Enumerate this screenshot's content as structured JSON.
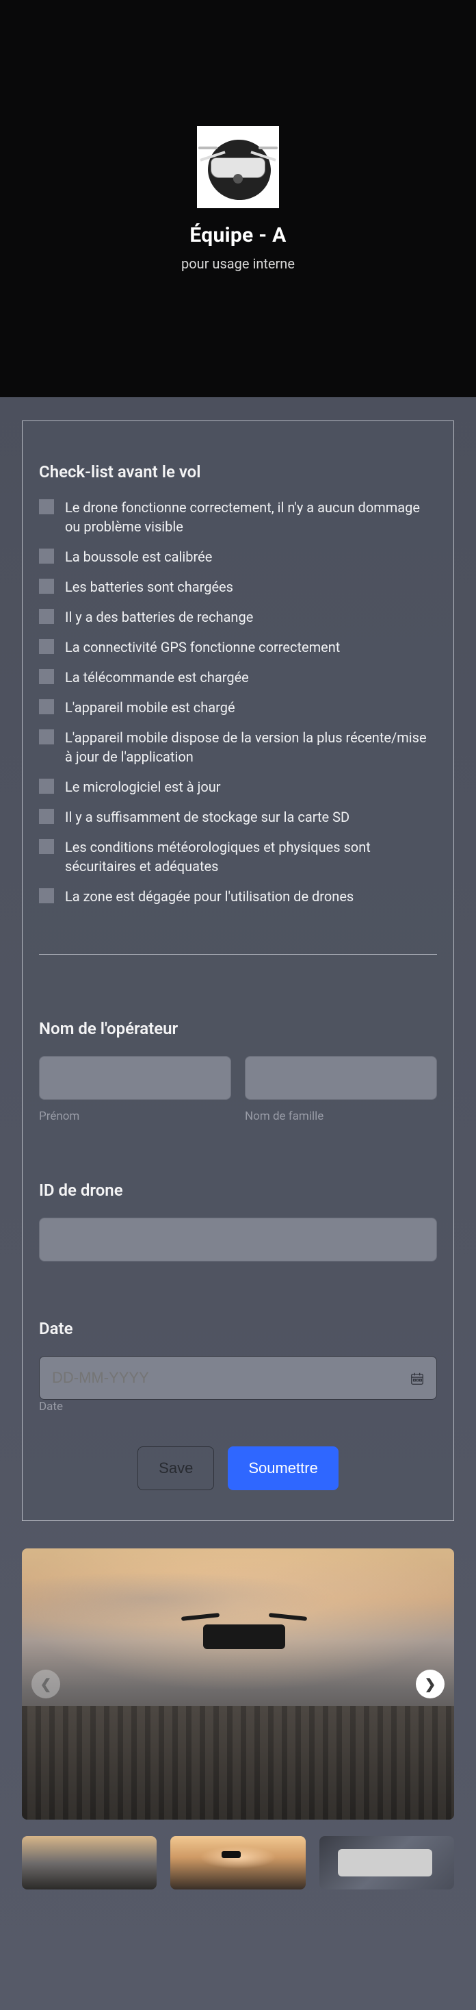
{
  "header": {
    "title": "Équipe - A",
    "subtitle": "pour usage interne"
  },
  "checklist": {
    "title": "Check-list avant le vol",
    "items": [
      "Le drone fonctionne correctement, il n'y a aucun dommage ou problème visible",
      "La boussole est calibrée",
      "Les batteries sont chargées",
      "Il y a des batteries de rechange",
      "La connectivité GPS fonctionne correctement",
      "La télécommande est chargée",
      "L'appareil mobile est chargé",
      "L'appareil mobile dispose de la version la plus récente/mise à jour de l'application",
      "Le micrologiciel est à jour",
      "Il y a suffisamment de stockage sur la carte SD",
      "Les conditions météorologiques et physiques sont sécuritaires et adéquates",
      "La zone est dégagée pour l'utilisation de drones"
    ]
  },
  "operator": {
    "label": "Nom de l'opérateur",
    "first_sub": "Prénom",
    "last_sub": "Nom de famille"
  },
  "drone": {
    "label": "ID de drone"
  },
  "date": {
    "label": "Date",
    "placeholder": "DD-MM-YYYY",
    "sub": "Date"
  },
  "buttons": {
    "save": "Save",
    "submit": "Soumettre"
  }
}
